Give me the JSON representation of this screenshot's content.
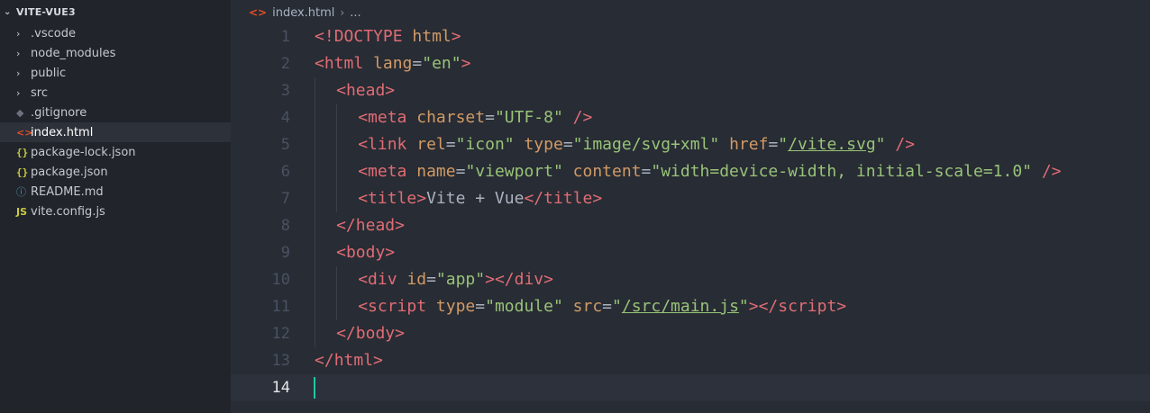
{
  "explorer": {
    "title": "VITE-VUE3",
    "items": [
      {
        "label": ".vscode",
        "icon": "chevron-right-icon",
        "type": "folder"
      },
      {
        "label": "node_modules",
        "icon": "chevron-right-icon",
        "type": "folder"
      },
      {
        "label": "public",
        "icon": "chevron-right-icon",
        "type": "folder"
      },
      {
        "label": "src",
        "icon": "chevron-right-icon",
        "type": "folder"
      },
      {
        "label": ".gitignore",
        "icon": "git-icon",
        "type": "file"
      },
      {
        "label": "index.html",
        "icon": "html-icon",
        "type": "file",
        "active": true
      },
      {
        "label": "package-lock.json",
        "icon": "json-icon",
        "type": "file"
      },
      {
        "label": "package.json",
        "icon": "json-icon",
        "type": "file"
      },
      {
        "label": "README.md",
        "icon": "info-icon",
        "type": "file"
      },
      {
        "label": "vite.config.js",
        "icon": "js-icon",
        "type": "file"
      }
    ]
  },
  "breadcrumb": {
    "file": "index.html",
    "more": "..."
  },
  "editor": {
    "current_line": 14,
    "lines": [
      {
        "n": "1",
        "indent": 0,
        "tokens": [
          [
            "tag",
            "<!"
          ],
          [
            "tag",
            "DOCTYPE"
          ],
          [
            "plain",
            " "
          ],
          [
            "attr",
            "html"
          ],
          [
            "tag",
            ">"
          ]
        ]
      },
      {
        "n": "2",
        "indent": 0,
        "tokens": [
          [
            "tag",
            "<"
          ],
          [
            "tag",
            "html"
          ],
          [
            "plain",
            " "
          ],
          [
            "attr",
            "lang"
          ],
          [
            "punct",
            "="
          ],
          [
            "str",
            "\"en\""
          ],
          [
            "tag",
            ">"
          ]
        ]
      },
      {
        "n": "3",
        "indent": 1,
        "tokens": [
          [
            "tag",
            "<"
          ],
          [
            "tag",
            "head"
          ],
          [
            "tag",
            ">"
          ]
        ]
      },
      {
        "n": "4",
        "indent": 2,
        "tokens": [
          [
            "tag",
            "<"
          ],
          [
            "tag",
            "meta"
          ],
          [
            "plain",
            " "
          ],
          [
            "attr",
            "charset"
          ],
          [
            "punct",
            "="
          ],
          [
            "str",
            "\"UTF-8\""
          ],
          [
            "plain",
            " "
          ],
          [
            "tag",
            "/>"
          ]
        ]
      },
      {
        "n": "5",
        "indent": 2,
        "tokens": [
          [
            "tag",
            "<"
          ],
          [
            "tag",
            "link"
          ],
          [
            "plain",
            " "
          ],
          [
            "attr",
            "rel"
          ],
          [
            "punct",
            "="
          ],
          [
            "str",
            "\"icon\""
          ],
          [
            "plain",
            " "
          ],
          [
            "attr",
            "type"
          ],
          [
            "punct",
            "="
          ],
          [
            "str",
            "\"image/svg+xml\""
          ],
          [
            "plain",
            " "
          ],
          [
            "attr",
            "href"
          ],
          [
            "punct",
            "="
          ],
          [
            "str",
            "\""
          ],
          [
            "link",
            "/vite.svg"
          ],
          [
            "str",
            "\""
          ],
          [
            "plain",
            " "
          ],
          [
            "tag",
            "/>"
          ]
        ]
      },
      {
        "n": "6",
        "indent": 2,
        "tokens": [
          [
            "tag",
            "<"
          ],
          [
            "tag",
            "meta"
          ],
          [
            "plain",
            " "
          ],
          [
            "attr",
            "name"
          ],
          [
            "punct",
            "="
          ],
          [
            "str",
            "\"viewport\""
          ],
          [
            "plain",
            " "
          ],
          [
            "attr",
            "content"
          ],
          [
            "punct",
            "="
          ],
          [
            "str",
            "\"width=device-width, initial-scale=1.0\""
          ],
          [
            "plain",
            " "
          ],
          [
            "tag",
            "/>"
          ]
        ]
      },
      {
        "n": "7",
        "indent": 2,
        "tokens": [
          [
            "tag",
            "<"
          ],
          [
            "tag",
            "title"
          ],
          [
            "tag",
            ">"
          ],
          [
            "plain",
            "Vite + Vue"
          ],
          [
            "tag",
            "</"
          ],
          [
            "tag",
            "title"
          ],
          [
            "tag",
            ">"
          ]
        ]
      },
      {
        "n": "8",
        "indent": 1,
        "tokens": [
          [
            "tag",
            "</"
          ],
          [
            "tag",
            "head"
          ],
          [
            "tag",
            ">"
          ]
        ]
      },
      {
        "n": "9",
        "indent": 1,
        "tokens": [
          [
            "tag",
            "<"
          ],
          [
            "tag",
            "body"
          ],
          [
            "tag",
            ">"
          ]
        ]
      },
      {
        "n": "10",
        "indent": 2,
        "tokens": [
          [
            "tag",
            "<"
          ],
          [
            "tag",
            "div"
          ],
          [
            "plain",
            " "
          ],
          [
            "attr",
            "id"
          ],
          [
            "punct",
            "="
          ],
          [
            "str",
            "\"app\""
          ],
          [
            "tag",
            "></"
          ],
          [
            "tag",
            "div"
          ],
          [
            "tag",
            ">"
          ]
        ]
      },
      {
        "n": "11",
        "indent": 2,
        "tokens": [
          [
            "tag",
            "<"
          ],
          [
            "tag",
            "script"
          ],
          [
            "plain",
            " "
          ],
          [
            "attr",
            "type"
          ],
          [
            "punct",
            "="
          ],
          [
            "str",
            "\"module\""
          ],
          [
            "plain",
            " "
          ],
          [
            "attr",
            "src"
          ],
          [
            "punct",
            "="
          ],
          [
            "str",
            "\""
          ],
          [
            "link",
            "/src/main.js"
          ],
          [
            "str",
            "\""
          ],
          [
            "tag",
            "></"
          ],
          [
            "tag",
            "script"
          ],
          [
            "tag",
            ">"
          ]
        ]
      },
      {
        "n": "12",
        "indent": 1,
        "tokens": [
          [
            "tag",
            "</"
          ],
          [
            "tag",
            "body"
          ],
          [
            "tag",
            ">"
          ]
        ]
      },
      {
        "n": "13",
        "indent": 0,
        "tokens": [
          [
            "tag",
            "</"
          ],
          [
            "tag",
            "html"
          ],
          [
            "tag",
            ">"
          ]
        ]
      },
      {
        "n": "14",
        "indent": 0,
        "tokens": []
      }
    ]
  },
  "colors": {
    "sidebar_bg": "#21252b",
    "editor_bg": "#282c34",
    "tag": "#e06c75",
    "attribute": "#d19a66",
    "string": "#98c379",
    "plain": "#abb2bf",
    "cursor": "#1ec8a5"
  }
}
